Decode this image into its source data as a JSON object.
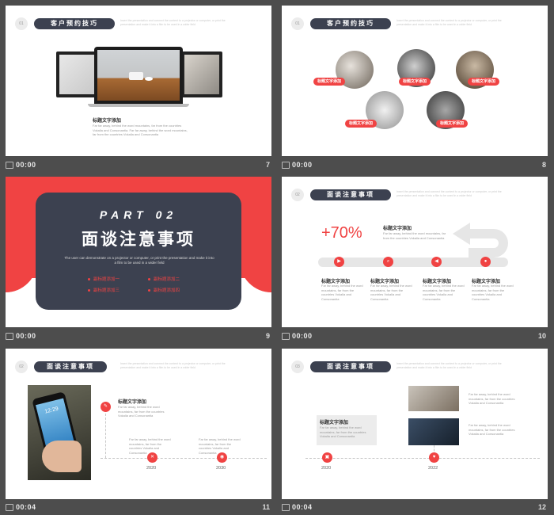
{
  "slides": [
    {
      "number": "7",
      "time": "00:00",
      "section": "01",
      "heading": "客户预约技巧",
      "caption_title": "标题文字添加",
      "caption_body": "Far far away, behind the word mountains, far from the countries Vokalia and Consonantia. Far far away, behind the word mountains, far from the countries Vokalia and Consonantia"
    },
    {
      "number": "8",
      "time": "00:00",
      "section": "01",
      "heading": "客户预约技巧",
      "tags": [
        "标题文字添加",
        "标题文字添加",
        "标题文字添加",
        "标题文字添加",
        "标题文字添加"
      ]
    },
    {
      "number": "9",
      "time": "00:00",
      "part": "PART 02",
      "title": "面谈注意事项",
      "subtitle": "The user can demonstrate on a projector or computer, or print the presentation and make it into a film to be used in a wider field",
      "bullets": [
        "副标题添加一",
        "副标题添加二",
        "副标题添加三",
        "副标题添加四"
      ]
    },
    {
      "number": "10",
      "time": "00:00",
      "section": "02",
      "heading": "面谈注意事项",
      "percent": "+70%",
      "big_title": "标题文字添加",
      "big_body": "Far far away, behind the word mountains, far from the countries Vokalia and Consonantia",
      "steps": [
        {
          "title": "标题文字添加",
          "body": "Far far away, behind the word mountains, far from the countries Vokalia and Consonantia"
        },
        {
          "title": "标题文字添加",
          "body": "Far far away, behind the word mountains, far from the countries Vokalia and Consonantia"
        },
        {
          "title": "标题文字添加",
          "body": "Far far away, behind the word mountains, far from the countries Vokalia and Consonantia"
        },
        {
          "title": "标题文字添加",
          "body": "Far far away, behind the word mountains, far from the countries Vokalia and Consonantia"
        }
      ]
    },
    {
      "number": "11",
      "time": "00:04",
      "section": "02",
      "heading": "面谈注意事项",
      "phone_time": "12:29",
      "top_title": "标题文字添加",
      "top_body": "Far far away, behind the word mountains, far from the countries Vokalia and Consonantia",
      "items": [
        {
          "body": "Far far away, behind the word mountains, far from the countries Vokalia and Consonantia",
          "year": "2020"
        },
        {
          "body": "Far far away, behind the word mountains, far from the countries Vokalia and Consonantia",
          "year": "2030"
        }
      ]
    },
    {
      "number": "12",
      "time": "00:04",
      "section": "03",
      "heading": "面谈注意事项",
      "box_title": "标题文字添加",
      "box_body": "Far far away, behind the word mountains, far from the countries Vokalia and Consonantia",
      "right_body_1": "Far far away, behind the word mountains, far from the countries Vokalia and Consonantia",
      "right_body_2": "Far far away, behind the word mountains, far from the countries Vokalia and Consonantia",
      "years": [
        "2020",
        "2022"
      ]
    }
  ],
  "faint_text": "Insert the presentation and connect the content to a projector or computer, or print the presentation and make it into a film to be used in a wider field",
  "colors": {
    "accent": "#f04343",
    "dark": "#3c4150",
    "background": "#4d4d4d"
  }
}
